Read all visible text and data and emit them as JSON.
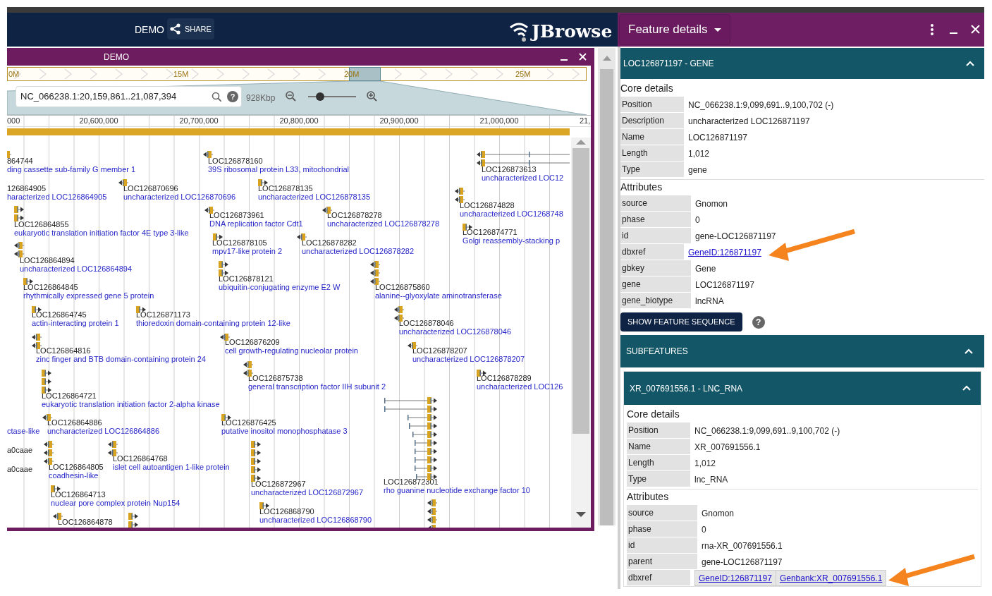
{
  "app_bar": {
    "session": "DEMO",
    "share": "SHARE",
    "logo": "JBrowse"
  },
  "view": {
    "title": "DEMO",
    "overview_labels": [
      "0M",
      "15M",
      "20M",
      "25M"
    ],
    "location": "NC_066238.1:20,159,861..21,087,394",
    "location_help": "?",
    "span": "928Kbp",
    "zoom": {
      "level": 0.25
    },
    "ruler_labels": [
      "000",
      "20,600,000",
      "20,700,000",
      "20,800,000",
      "20,900,000",
      "21,000,000",
      "21,"
    ],
    "features": [
      {
        "name": "864744",
        "description": "ding cassette sub-family G member 1",
        "kind": "minus"
      },
      {
        "name": "LOC126878160",
        "description": "39S ribosomal protein L33, mitochondrial",
        "kind": "minus"
      },
      {
        "name": "LOC126873613",
        "description": "uncharacterized LOC12",
        "kind": "minus"
      },
      {
        "name": "126864905",
        "description": "haracterized LOC126864905"
      },
      {
        "name": "LOC126870696",
        "description": "uncharacterized LOC126870696",
        "kind": "minus"
      },
      {
        "name": "LOC126878135",
        "description": "uncharacterized LOC126878135",
        "kind": "plus"
      },
      {
        "name": "LOC126874828",
        "description": "uncharacterized LOC1268748",
        "kind": "minus"
      },
      {
        "name": "LOC126864855",
        "description": "eukaryotic translation initiation factor 4E type 3-like",
        "kind": "plus"
      },
      {
        "name": "LOC126873961",
        "description": "DNA replication factor Cdt1",
        "kind": "minus"
      },
      {
        "name": "LOC126878278",
        "description": "uncharacterized LOC126878278",
        "kind": "minus"
      },
      {
        "name": "LOC126874771",
        "description": "Golgi reassembly-stacking p",
        "kind": "plus"
      },
      {
        "name": "LOC126878105",
        "description": "mpv17-like protein 2",
        "kind": "plus"
      },
      {
        "name": "LOC126878282",
        "description": "uncharacterized LOC126878282",
        "kind": "minus"
      },
      {
        "name": "LOC126864894",
        "description": "uncharacterized LOC126864894",
        "kind": "minus"
      },
      {
        "name": "LOC126878121",
        "description": "ubiquitin-conjugating enzyme E2 W",
        "kind": "plus"
      },
      {
        "name": "LOC126864845",
        "description": "rhythmically expressed gene 5 protein",
        "kind": "plus"
      },
      {
        "name": "LOC126875860",
        "description": "alanine--glyoxylate aminotransferase",
        "kind": "minus"
      },
      {
        "name": "LOC126864745",
        "description": "actin-interacting protein 1",
        "kind": "plus"
      },
      {
        "name": "LOC126871173",
        "description": "thioredoxin domain-containing protein 12-like",
        "kind": "plus"
      },
      {
        "name": "LOC126878046",
        "description": "uncharacterized LOC126878046",
        "kind": "minus"
      },
      {
        "name": "LOC126876209",
        "description": "cell growth-regulating nucleolar protein",
        "kind": "minus"
      },
      {
        "name": "LOC126864816",
        "description": "zinc finger and BTB domain-containing protein 24",
        "kind": "minus"
      },
      {
        "name": "LOC126878207",
        "description": "uncharacterized LOC126878207",
        "kind": "minus"
      },
      {
        "name": "LOC126875738",
        "description": "general transcription factor IIH subunit 2",
        "kind": "minus"
      },
      {
        "name": "LOC126878289",
        "description": "uncharacterized LOC126",
        "kind": "plus"
      },
      {
        "name": "LOC126864721",
        "description": "eukaryotic translation initiation factor 2-alpha kinase",
        "kind": "plus"
      },
      {
        "description": "ctase-like"
      },
      {
        "name": "LOC126864886",
        "description": "uncharacterized LOC126864886",
        "kind": "minus"
      },
      {
        "name": "LOC126876425",
        "description": "putative inositol monophosphatase 3",
        "kind": "plus"
      },
      {
        "name": "a0caae"
      },
      {
        "name": "a0caae"
      },
      {
        "name": "LOC126864768",
        "description": "islet cell autoantigen 1-like protein",
        "kind": "minus"
      },
      {
        "name": "LOC126864805",
        "description": "coadhesin-like",
        "kind": "minus"
      },
      {
        "name": "LOC126872967",
        "description": "uncharacterized LOC126872967",
        "kind": "plus"
      },
      {
        "name": "LOC126872301",
        "description": "rho guanine nucleotide exchange factor 10",
        "kind": "plus"
      },
      {
        "name": "LOC126864713",
        "description": "nuclear pore complex protein Nup154",
        "kind": "plus"
      },
      {
        "name": "LOC126864878",
        "kind": "minus"
      },
      {
        "name": "LOC126868790",
        "description": "uncharacterized LOC126868790",
        "kind": "plus"
      }
    ]
  },
  "detail_panel": {
    "title": "Feature details",
    "feature": {
      "header": "LOC126871197 - GENE",
      "expanded": true,
      "core_title": "Core details",
      "core": [
        {
          "label": "Position",
          "value": "NC_066238.1:9,099,691..9,100,702 (-)"
        },
        {
          "label": "Description",
          "value": "uncharacterized LOC126871197"
        },
        {
          "label": "Name",
          "value": "LOC126871197"
        },
        {
          "label": "Length",
          "value": "1,012"
        },
        {
          "label": "Type",
          "value": "gene"
        }
      ],
      "attributes_title": "Attributes",
      "attributes": [
        {
          "label": "source",
          "value": "Gnomon"
        },
        {
          "label": "phase",
          "value": "0"
        },
        {
          "label": "id",
          "value": "gene-LOC126871197"
        },
        {
          "label": "dbxref",
          "links": [
            "GeneID:126871197"
          ]
        },
        {
          "label": "gbkey",
          "value": "Gene"
        },
        {
          "label": "gene",
          "value": "LOC126871197"
        },
        {
          "label": "gene_biotype",
          "value": "lncRNA"
        }
      ],
      "sequence_button": "SHOW FEATURE SEQUENCE",
      "sequence_help": "?"
    },
    "subfeatures": {
      "header": "SUBFEATURES",
      "expanded": true,
      "items": [
        {
          "header": "XR_007691556.1 - LNC_RNA",
          "expanded": true,
          "core_title": "Core details",
          "core": [
            {
              "label": "Position",
              "value": "NC_066238.1:9,099,691..9,100,702 (-)"
            },
            {
              "label": "Name",
              "value": "XR_007691556.1"
            },
            {
              "label": "Length",
              "value": "1,012"
            },
            {
              "label": "Type",
              "value": "lnc_RNA"
            }
          ],
          "attributes_title": "Attributes",
          "attributes": [
            {
              "label": "source",
              "value": "Gnomon"
            },
            {
              "label": "phase",
              "value": "0"
            },
            {
              "label": "id",
              "value": "rna-XR_007691556.1"
            },
            {
              "label": "parent",
              "value": "gene-LOC126871197"
            },
            {
              "label": "dbxref",
              "links": [
                "GeneID:126871197",
                "Genbank:XR_007691556.1"
              ]
            }
          ]
        }
      ]
    }
  }
}
